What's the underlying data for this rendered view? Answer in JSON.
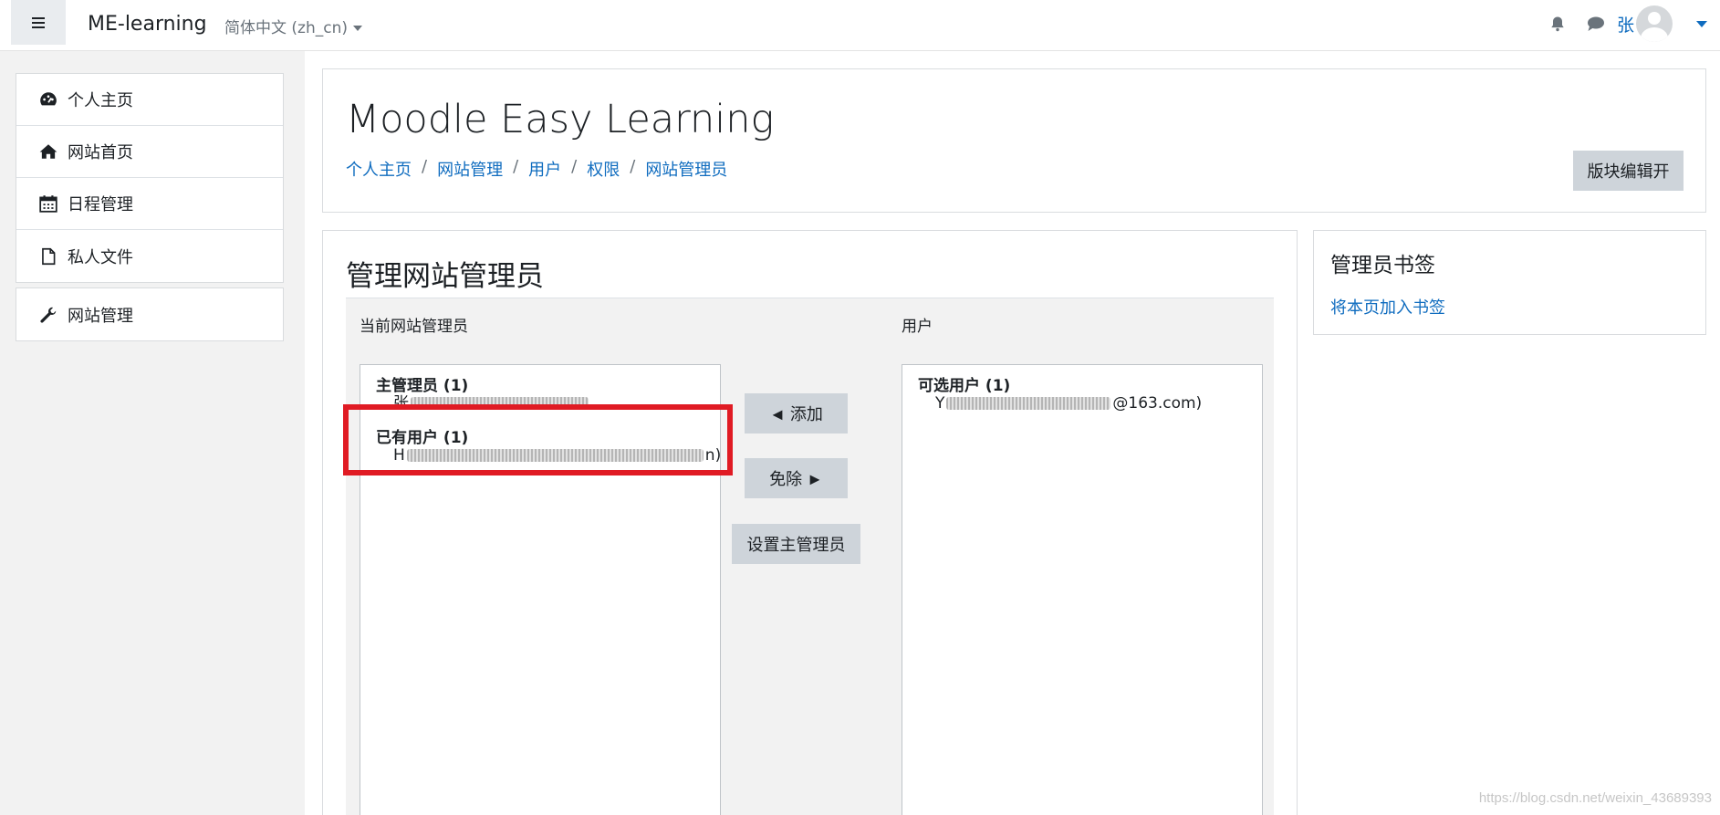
{
  "navbar": {
    "brand": "ME-learning",
    "language": "简体中文 (zh_cn)",
    "user_name": "张"
  },
  "drawer": {
    "items": [
      {
        "label": "个人主页",
        "icon": "dashboard-icon"
      },
      {
        "label": "网站首页",
        "icon": "home-icon"
      },
      {
        "label": "日程管理",
        "icon": "calendar-icon"
      },
      {
        "label": "私人文件",
        "icon": "file-icon"
      }
    ],
    "admin_item": {
      "label": "网站管理",
      "icon": "wrench-icon"
    }
  },
  "header": {
    "title": "Moodle Easy Learning",
    "breadcrumb": [
      "个人主页",
      "网站管理",
      "用户",
      "权限",
      "网站管理员"
    ],
    "edit_button": "版块编辑开"
  },
  "admins_section": {
    "title": "管理网站管理员",
    "current_label": "当前网站管理员",
    "users_label": "用户",
    "current_groups": [
      {
        "title": "主管理员 (1)",
        "option": "张"
      },
      {
        "title": "已有用户 (1)",
        "option_start": "H",
        "option_end": "n)"
      }
    ],
    "available_group": {
      "title": "可选用户 (1)",
      "option_start": "Y",
      "option_end": "@163.com)"
    },
    "buttons": {
      "add": "◄ 添加",
      "remove": "免除 ►",
      "set_main": "设置主管理员"
    }
  },
  "side_block": {
    "title": "管理员书签",
    "link": "将本页加入书签"
  },
  "watermark": "https://blog.csdn.net/weixin_43689393",
  "colors": {
    "link": "#0f6cbf",
    "button": "#ced4da",
    "highlight": "#e01b24"
  }
}
